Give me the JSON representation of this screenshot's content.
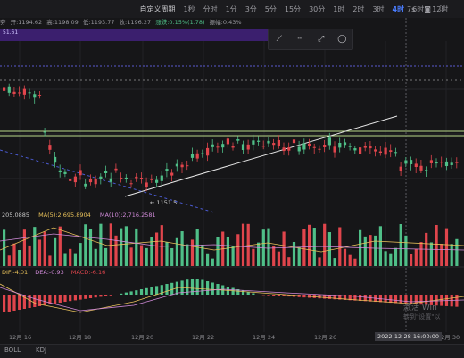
{
  "ohlc": {
    "prefix": "夯",
    "open": "开:1194.62",
    "high": "高:1198.09",
    "low": "低:1193.77",
    "close": "收:1196.27",
    "change": "涨跌:0.15%(1.78)",
    "amplitude": "振幅:0.43%"
  },
  "toolbar": {
    "periods": [
      "自定义周期",
      "1秒",
      "分时",
      "1分",
      "3分",
      "5分",
      "15分",
      "30分",
      "1时",
      "2时",
      "3时",
      "4时",
      "6时",
      "12时"
    ],
    "active_period": "4时",
    "right_label": "7s",
    "right_icons": [
      "camera-icon",
      "expand-icon"
    ]
  },
  "purple_price": "51.61",
  "draw_tools": [
    "line-tool-icon",
    "ray-tool-icon",
    "extend-line-icon",
    "circle-tool-icon"
  ],
  "price_annotation": "← 1151.5",
  "indicators": {
    "vol_label": "205.0885",
    "ma5": "MA(5):2,695.8904",
    "ma10": "MA(10):2,716.2581",
    "dif": "DIF:-4.01",
    "dea": "DEA:-0.93",
    "macd": "MACD:-6.16"
  },
  "x_axis": {
    "labels": [
      "12月 16",
      "12月 18",
      "12月 20",
      "12月 22",
      "12月 24",
      "12月 26",
      "12月 30"
    ],
    "hover_time": "2022-12-28 16:00:00"
  },
  "bottom_tabs": [
    "BOLL",
    "KDJ"
  ],
  "watermark": {
    "line1": "激活 Win",
    "line2": "转到\"设置\"以"
  },
  "colors": {
    "up": "#4fbf88",
    "down": "#e0454c",
    "active_tab": "#4a7dff",
    "purple_band": "#3b1f6e"
  }
}
